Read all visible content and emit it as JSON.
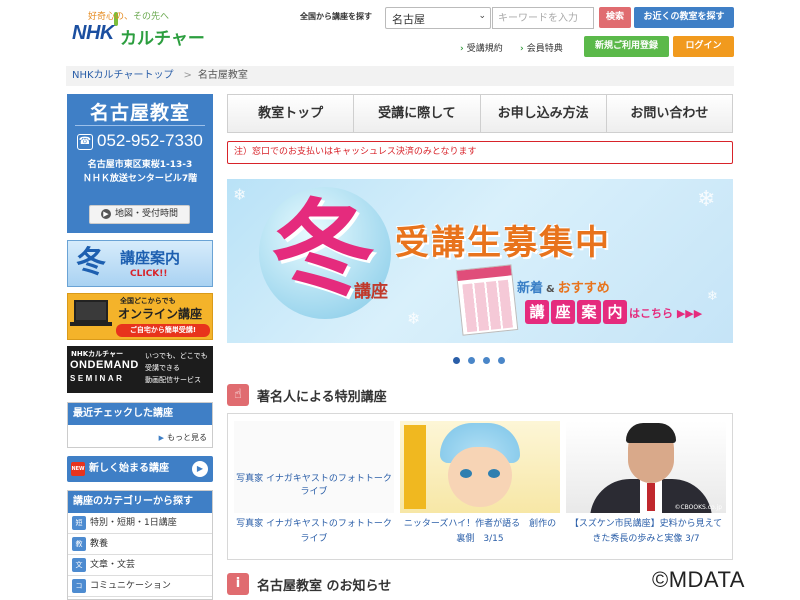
{
  "header": {
    "logo": {
      "tagline_a": "好奇心の、",
      "tagline_b": "その先へ",
      "brand": "NHK",
      "brand_kana": "カルチャー"
    },
    "search_label": "全国から講座を探す",
    "area_select": "名古屋",
    "keyword_placeholder": "キーワードを入力",
    "search_button": "検索",
    "nearby_button": "お近くの教室を探す",
    "links": [
      "受講規約",
      "会員特典"
    ],
    "register_button": "新規ご利用登録",
    "login_button": "ログイン",
    "colors": {
      "search": "#e06c70",
      "nearby": "#3f7fc6",
      "register": "#5bb94a",
      "login": "#f19a1e"
    }
  },
  "breadcrumb": [
    "NHKカルチャートップ",
    "名古屋教室"
  ],
  "sidebar": {
    "class_name": "名古屋教室",
    "tel": "052-952-7330",
    "address_line1": "名古屋市東区東桜1-13-3",
    "address_line2": "ＮＨＫ放送センタービル7階",
    "map_button": "地図・受付時間",
    "banner_winter": {
      "kanji": "冬",
      "title": "講座案内",
      "click": "CLICK!!"
    },
    "banner_online": {
      "line1": "全国どこからでも",
      "line2": "オンライン講座",
      "line3": "ご自宅から簡単受講!"
    },
    "banner_ondemand": {
      "nhk": "NHKカルチャー",
      "main": "ONDEMAND",
      "sub": "SEMINAR",
      "right1": "いつでも、どこでも",
      "right2": "受講できる",
      "right3": "動画配信サービス"
    },
    "recent": {
      "title": "最近チェックした講座",
      "more": "もっと見る"
    },
    "new_courses": {
      "badge": "NEW",
      "label": "新しく始まる講座"
    },
    "categories": {
      "title": "講座のカテゴリーから探す",
      "items": [
        {
          "icon": "短",
          "label": "特別・短期・1日講座"
        },
        {
          "icon": "教",
          "label": "教養"
        },
        {
          "icon": "文",
          "label": "文章・文芸"
        },
        {
          "icon": "コ",
          "label": "コミュニケーション"
        }
      ]
    }
  },
  "main": {
    "tabs": [
      "教室トップ",
      "受講に際して",
      "お申し込み方法",
      "お問い合わせ"
    ],
    "notice": "注）窓口でのお支払いはキャッシュレス決済のみとなります",
    "hero": {
      "kanji": "冬",
      "sub": "講座",
      "title": "受講生募集中",
      "paper_label": "講座案内",
      "new_text": "新着",
      "amp": "&",
      "recommend": "おすすめ",
      "pills": [
        "講",
        "座",
        "案",
        "内"
      ],
      "more": "はこちら ▶▶▶"
    },
    "carousel": {
      "total": 4,
      "active": 1
    },
    "special": {
      "title": "著名人による特別講座",
      "cards": [
        {
          "image_alt": "写真家 イナガキヤストのフォトトークライブ",
          "caption": "写真家 イナガキヤストのフォトトークライブ"
        },
        {
          "caption": "ニッターズハイ！作者が語る　創作の裏側　3/15"
        },
        {
          "caption": "【スズケン市民講座】史料から見えてきた秀長の歩みと実像 3/7",
          "credit": "©CBOOKS.co.jp"
        }
      ]
    },
    "news": {
      "title": "名古屋教室 のお知らせ"
    }
  },
  "watermark": "©MDATA"
}
